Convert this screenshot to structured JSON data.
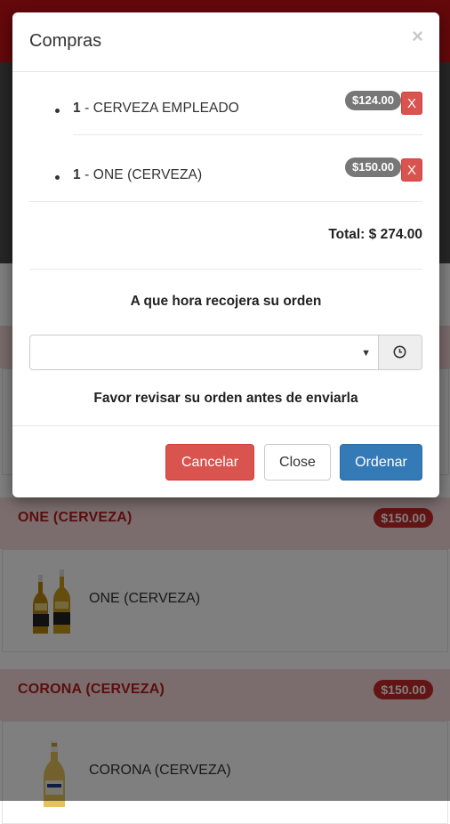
{
  "products": [
    {
      "title": "ONE (CERVEZA)",
      "price": "$150.00",
      "name": "ONE (CERVEZA)",
      "image_icon": "beer-bottles-icon"
    },
    {
      "title": "CORONA (CERVEZA)",
      "price": "$150.00",
      "name": "CORONA (CERVEZA)",
      "image_icon": "beer-bottle-icon"
    }
  ],
  "modal": {
    "title": "Compras",
    "close_symbol": "×",
    "items": [
      {
        "qty": "1",
        "name": " - CERVEZA EMPLEADO",
        "price": "$124.00",
        "remove_label": "X"
      },
      {
        "qty": "1",
        "name": " - ONE (CERVEZA)",
        "price": "$150.00",
        "remove_label": "X"
      }
    ],
    "total": "Total: $ 274.00",
    "pickup_label": "A que hora recojera su orden",
    "pickup_time": "",
    "review_note": "Favor revisar su orden antes de enviarla",
    "buttons": {
      "cancel": "Cancelar",
      "close": "Close",
      "order": "Ordenar"
    }
  },
  "colors": {
    "brand_red": "#c91017",
    "danger": "#d9534f",
    "primary": "#337ab7",
    "badge_gray": "#777777"
  }
}
